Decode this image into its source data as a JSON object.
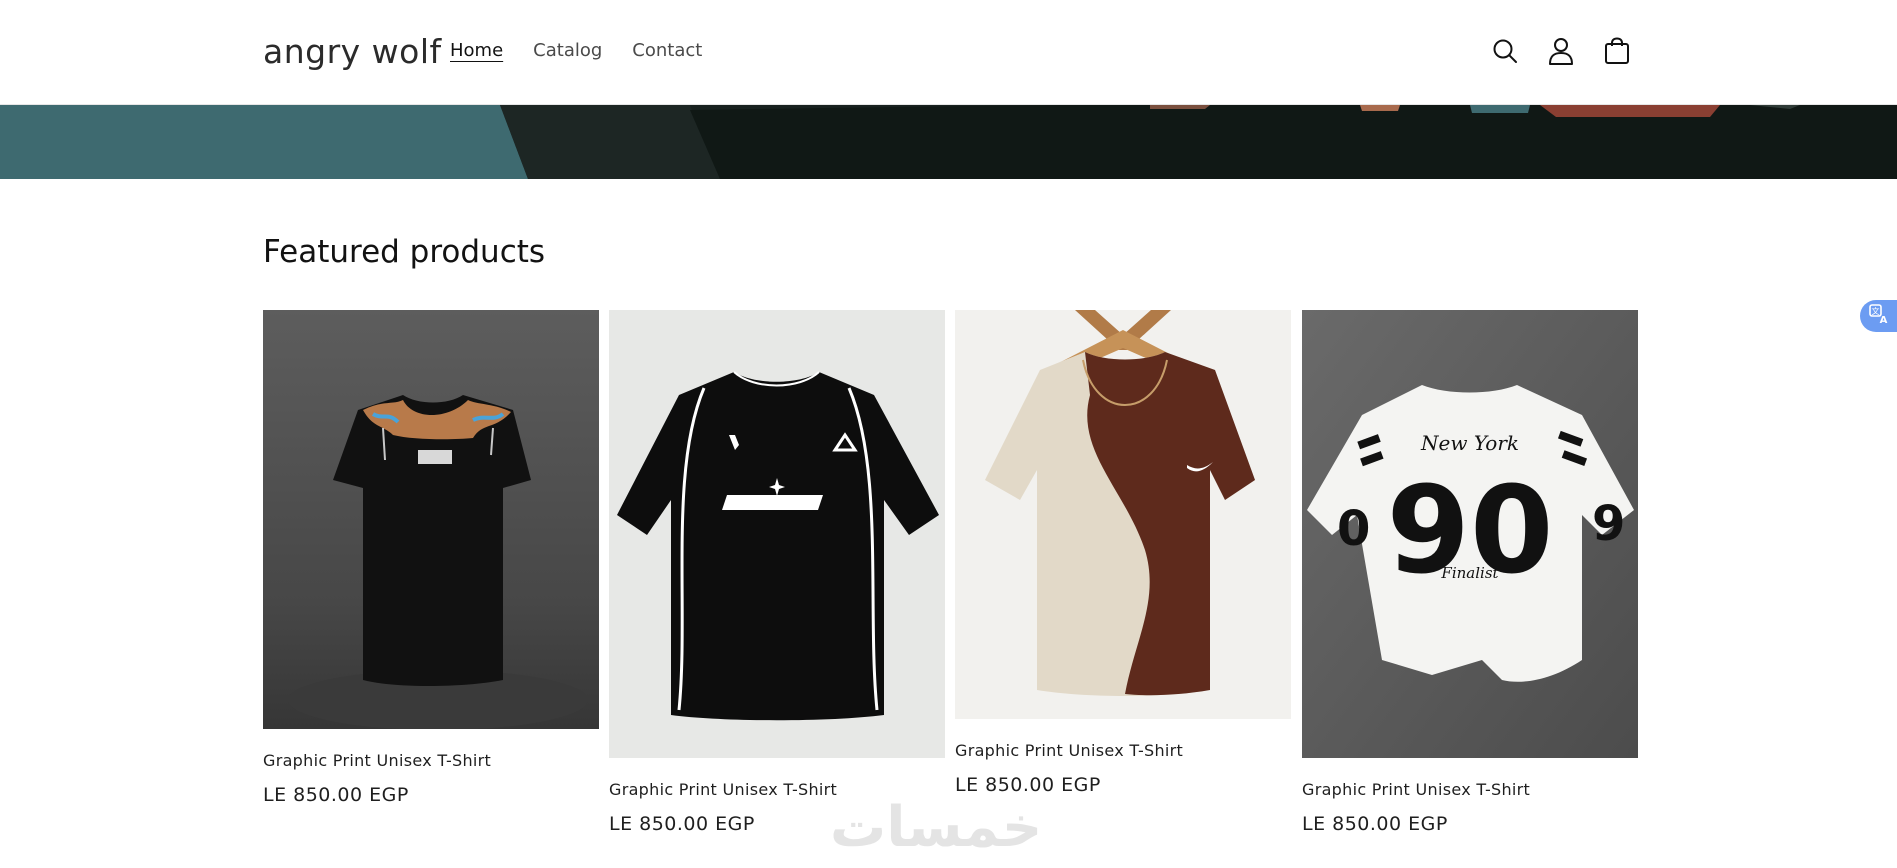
{
  "store": {
    "name": "angry wolf"
  },
  "nav": [
    {
      "label": "Home",
      "active": true
    },
    {
      "label": "Catalog",
      "active": false
    },
    {
      "label": "Contact",
      "active": false
    }
  ],
  "header_icons": [
    "search-icon",
    "account-icon",
    "cart-icon"
  ],
  "featured": {
    "title": "Featured products",
    "products": [
      {
        "title": "Graphic Print Unisex T-Shirt",
        "price": "LE 850.00 EGP",
        "image": "black-tshirt-floral-print"
      },
      {
        "title": "Graphic Print Unisex T-Shirt",
        "price": "LE 850.00 EGP",
        "image": "black-sport-jersey-tshirt"
      },
      {
        "title": "Graphic Print Unisex T-Shirt",
        "price": "LE 850.00 EGP",
        "image": "beige-brown-colorblock-tshirt"
      },
      {
        "title": "Graphic Print Unisex T-Shirt",
        "price": "LE 850.00 EGP",
        "image": "white-90-newyork-tshirt"
      }
    ]
  },
  "watermark": {
    "text": "خمسات"
  },
  "colors": {
    "accent": "#121212",
    "banner_teal": "#3e6a70",
    "banner_dark": "#18211f",
    "translate_button": "#6c9cf2"
  }
}
